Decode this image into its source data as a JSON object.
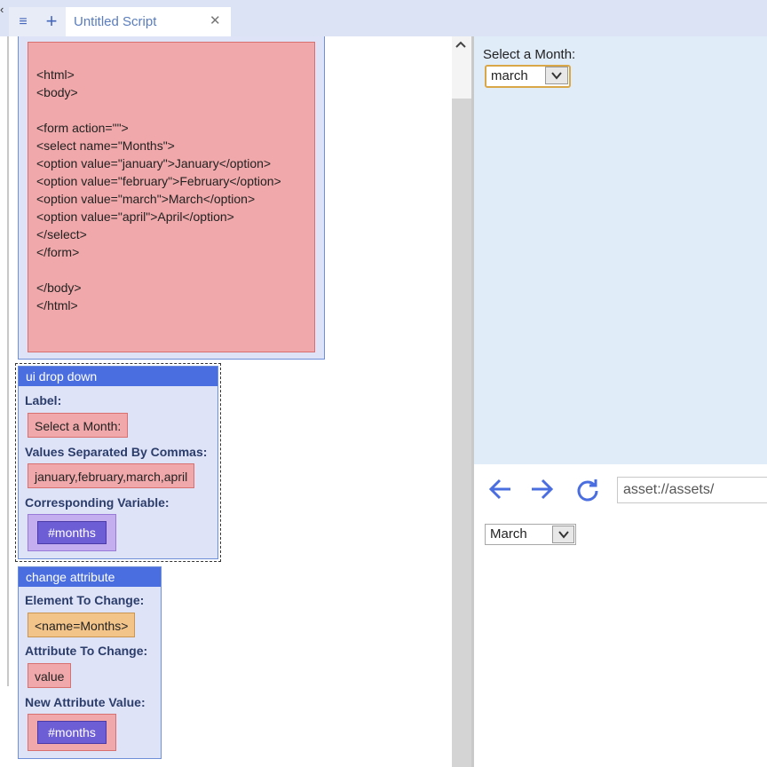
{
  "tab": {
    "title": "Untitled Script",
    "menu_icon": "≡",
    "plus_icon": "+",
    "close_icon": "✕"
  },
  "html_block": {
    "code": "<html>\n<body>\n\n<form action=\"\">\n<select name=\"Months\">\n<option value=\"january\">January</option>\n<option value=\"february\">February</option>\n<option value=\"march\">March</option>\n<option value=\"april\">April</option>\n</select>\n</form>\n\n</body>\n</html>"
  },
  "dropdown_block": {
    "title": "ui drop down",
    "label_caption": "Label:",
    "label_value": "Select a Month:",
    "values_caption": "Values Separated By Commas:",
    "values_value": "january,february,march,april",
    "variable_caption": "Corresponding Variable:",
    "variable_value": "#months"
  },
  "change_block": {
    "title": "change attribute",
    "element_caption": "Element To Change:",
    "element_value": "<name=Months>",
    "attribute_caption": "Attribute To Change:",
    "attribute_value": "value",
    "new_value_caption": "New Attribute Value:",
    "new_value_value": "#months"
  },
  "preview": {
    "label": "Select a Month:",
    "selected": "march"
  },
  "browser": {
    "address": "asset://assets/",
    "result_selected": "March"
  },
  "colors": {
    "accent": "#4a6ee0",
    "block_bg": "#dfe3f7",
    "code_bg": "#f0a8aa",
    "variable": "#6e5ed6",
    "preview_bg": "#e1ecf9"
  }
}
